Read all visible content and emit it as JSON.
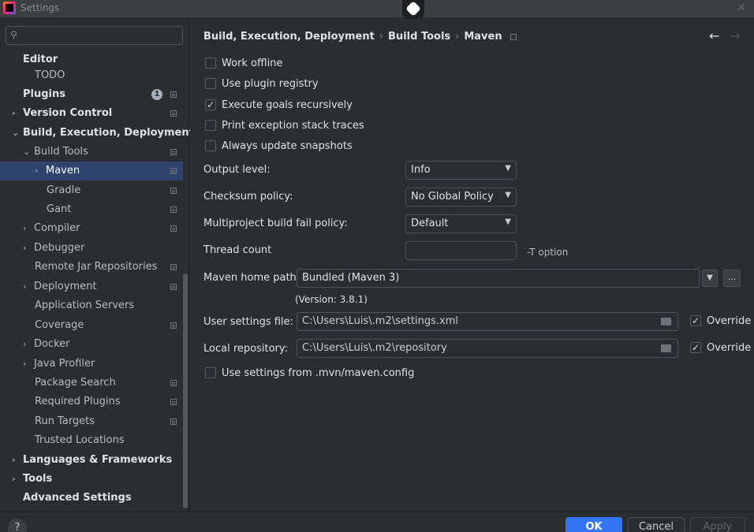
{
  "window": {
    "title": "Settings"
  },
  "search": {
    "placeholder": ""
  },
  "sidebar": {
    "items": [
      {
        "label": "Editor",
        "bold": true
      },
      {
        "label": "TODO"
      },
      {
        "label": "Plugins",
        "bold": true,
        "badge": "1"
      },
      {
        "label": "Version Control",
        "bold": true
      },
      {
        "label": "Build, Execution, Deployment",
        "bold": true
      },
      {
        "label": "Build Tools"
      },
      {
        "label": "Maven",
        "selected": true
      },
      {
        "label": "Gradle"
      },
      {
        "label": "Gant"
      },
      {
        "label": "Compiler"
      },
      {
        "label": "Debugger"
      },
      {
        "label": "Remote Jar Repositories"
      },
      {
        "label": "Deployment"
      },
      {
        "label": "Application Servers"
      },
      {
        "label": "Coverage"
      },
      {
        "label": "Docker"
      },
      {
        "label": "Java Profiler"
      },
      {
        "label": "Package Search"
      },
      {
        "label": "Required Plugins"
      },
      {
        "label": "Run Targets"
      },
      {
        "label": "Trusted Locations"
      },
      {
        "label": "Languages & Frameworks",
        "bold": true
      },
      {
        "label": "Tools",
        "bold": true
      },
      {
        "label": "Advanced Settings",
        "bold": true
      }
    ]
  },
  "breadcrumb": {
    "part1": "Build, Execution, Deployment",
    "part2": "Build Tools",
    "part3": "Maven",
    "sep": "›"
  },
  "options": {
    "work_offline": {
      "label": "Work offline",
      "checked": false
    },
    "use_plugin_registry": {
      "label": "Use plugin registry",
      "checked": false
    },
    "execute_goals_recursively": {
      "label": "Execute goals recursively",
      "checked": true
    },
    "print_exception_stack_traces": {
      "label": "Print exception stack traces",
      "checked": false
    },
    "always_update_snapshots": {
      "label": "Always update snapshots",
      "checked": false
    },
    "use_settings_from_mvn": {
      "label": "Use settings from .mvn/maven.config",
      "checked": false
    }
  },
  "fields": {
    "output_level": {
      "label": "Output level:",
      "value": "Info"
    },
    "checksum_policy": {
      "label": "Checksum policy:",
      "value": "No Global Policy"
    },
    "multiproject_policy": {
      "label": "Multiproject build fail policy:",
      "value": "Default"
    },
    "thread_count": {
      "label": "Thread count",
      "value": "",
      "option": "-T option"
    },
    "maven_home": {
      "label": "Maven home path:",
      "value": "Bundled (Maven 3)",
      "version": "(Version: 3.8.1)",
      "browse": "..."
    },
    "user_settings": {
      "label": "User settings file:",
      "value": "C:\\Users\\Luis\\.m2\\settings.xml",
      "override_label": "Override",
      "override": true
    },
    "local_repository": {
      "label": "Local repository:",
      "value": "C:\\Users\\Luis\\.m2\\repository",
      "override_label": "Override",
      "override": true
    }
  },
  "buttons": {
    "ok": "OK",
    "cancel": "Cancel",
    "apply": "Apply",
    "help": "?"
  },
  "colors": {
    "accent": "#3574f0",
    "selection": "#2e436e",
    "background": "#2b2d30"
  }
}
